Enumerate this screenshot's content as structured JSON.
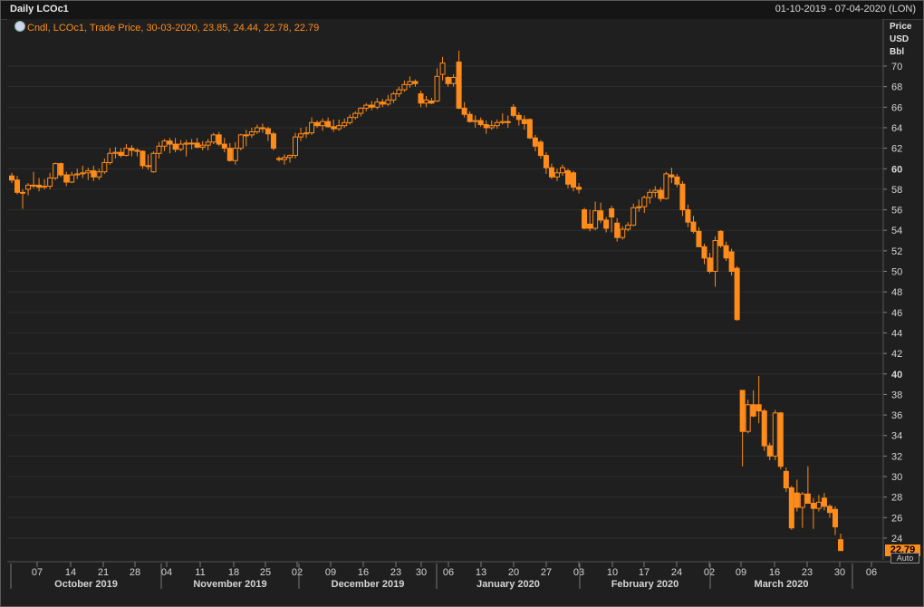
{
  "header": {
    "title": "Daily LCOc1",
    "date_range": "01-10-2019 - 07-04-2020 (LON)"
  },
  "legend": {
    "text": "Cndl, LCOc1, Trade Price, 30-03-2020, 23.85, 24.44, 22.78, 22.79"
  },
  "axis_units": [
    "Price",
    "USD",
    "Bbl"
  ],
  "last_price_label": "22.79",
  "auto_label": "Auto",
  "colors": {
    "candle": "#ff8c1a",
    "background": "#1f1f1f",
    "grid": "#2e2e2e"
  },
  "chart_data": {
    "type": "candlestick",
    "title": "Daily LCOc1",
    "series_name": "LCOc1",
    "ylim": [
      22,
      72
    ],
    "yticks": [
      24,
      26,
      28,
      30,
      32,
      34,
      36,
      38,
      40,
      42,
      44,
      46,
      48,
      50,
      52,
      54,
      56,
      58,
      60,
      62,
      64,
      66,
      68,
      70
    ],
    "bold_yticks": [
      40,
      60
    ],
    "x_tick_labels": [
      "07",
      "14",
      "21",
      "28",
      "04",
      "11",
      "18",
      "25",
      "02",
      "09",
      "16",
      "23",
      "30",
      "06",
      "13",
      "20",
      "27",
      "03",
      "10",
      "17",
      "24",
      "02",
      "09",
      "16",
      "23",
      "30",
      "06"
    ],
    "months": [
      "October 2019",
      "November 2019",
      "December 2019",
      "January 2020",
      "February 2020",
      "March 2020"
    ],
    "candles": [
      {
        "d": "2019-10-01",
        "o": 59.3,
        "h": 59.6,
        "l": 58.6,
        "c": 58.9
      },
      {
        "d": "2019-10-02",
        "o": 58.9,
        "h": 59.3,
        "l": 57.5,
        "c": 57.7
      },
      {
        "d": "2019-10-03",
        "o": 57.7,
        "h": 58.0,
        "l": 56.1,
        "c": 57.7
      },
      {
        "d": "2019-10-04",
        "o": 58.0,
        "h": 58.6,
        "l": 57.4,
        "c": 58.4
      },
      {
        "d": "2019-10-07",
        "o": 58.4,
        "h": 59.7,
        "l": 58.1,
        "c": 58.4
      },
      {
        "d": "2019-10-08",
        "o": 58.4,
        "h": 59.1,
        "l": 57.8,
        "c": 58.2
      },
      {
        "d": "2019-10-09",
        "o": 58.2,
        "h": 59.0,
        "l": 58.0,
        "c": 58.3
      },
      {
        "d": "2019-10-10",
        "o": 58.3,
        "h": 59.6,
        "l": 58.0,
        "c": 59.1
      },
      {
        "d": "2019-10-11",
        "o": 59.1,
        "h": 60.6,
        "l": 58.9,
        "c": 60.5
      },
      {
        "d": "2019-10-14",
        "o": 60.5,
        "h": 60.6,
        "l": 59.2,
        "c": 59.4
      },
      {
        "d": "2019-10-15",
        "o": 59.4,
        "h": 59.7,
        "l": 58.3,
        "c": 58.7
      },
      {
        "d": "2019-10-16",
        "o": 58.7,
        "h": 59.7,
        "l": 58.6,
        "c": 59.4
      },
      {
        "d": "2019-10-17",
        "o": 59.4,
        "h": 60.0,
        "l": 59.0,
        "c": 59.5
      },
      {
        "d": "2019-10-18",
        "o": 59.5,
        "h": 60.3,
        "l": 59.1,
        "c": 59.6
      },
      {
        "d": "2019-10-21",
        "o": 59.6,
        "h": 60.1,
        "l": 58.9,
        "c": 59.8
      },
      {
        "d": "2019-10-22",
        "o": 59.8,
        "h": 60.3,
        "l": 58.8,
        "c": 59.2
      },
      {
        "d": "2019-10-23",
        "o": 59.2,
        "h": 60.0,
        "l": 58.9,
        "c": 59.7
      },
      {
        "d": "2019-10-24",
        "o": 59.7,
        "h": 61.0,
        "l": 59.5,
        "c": 60.6
      },
      {
        "d": "2019-10-25",
        "o": 60.6,
        "h": 62.0,
        "l": 60.4,
        "c": 61.5
      },
      {
        "d": "2019-10-28",
        "o": 61.5,
        "h": 62.1,
        "l": 61.0,
        "c": 61.6
      },
      {
        "d": "2019-10-29",
        "o": 61.6,
        "h": 62.0,
        "l": 61.1,
        "c": 61.3
      },
      {
        "d": "2019-10-30",
        "o": 61.3,
        "h": 62.4,
        "l": 61.2,
        "c": 62.0
      },
      {
        "d": "2019-10-31",
        "o": 62.0,
        "h": 62.3,
        "l": 61.2,
        "c": 61.8
      },
      {
        "d": "2019-11-01",
        "o": 61.8,
        "h": 62.0,
        "l": 61.2,
        "c": 61.7
      },
      {
        "d": "2019-11-04",
        "o": 61.7,
        "h": 61.8,
        "l": 60.0,
        "c": 60.3
      },
      {
        "d": "2019-11-05",
        "o": 60.3,
        "h": 61.4,
        "l": 59.9,
        "c": 60.3
      },
      {
        "d": "2019-11-06",
        "o": 59.7,
        "h": 61.7,
        "l": 59.6,
        "c": 61.5
      },
      {
        "d": "2019-11-07",
        "o": 61.5,
        "h": 62.6,
        "l": 61.0,
        "c": 62.2
      },
      {
        "d": "2019-11-08",
        "o": 62.2,
        "h": 62.9,
        "l": 61.7,
        "c": 62.7
      },
      {
        "d": "2019-11-11",
        "o": 62.7,
        "h": 63.0,
        "l": 61.5,
        "c": 62.4
      },
      {
        "d": "2019-11-12",
        "o": 62.4,
        "h": 63.0,
        "l": 61.6,
        "c": 61.9
      },
      {
        "d": "2019-11-13",
        "o": 61.9,
        "h": 62.8,
        "l": 61.7,
        "c": 62.4
      },
      {
        "d": "2019-11-14",
        "o": 62.4,
        "h": 62.8,
        "l": 61.2,
        "c": 62.5
      },
      {
        "d": "2019-11-15",
        "o": 62.5,
        "h": 62.9,
        "l": 61.9,
        "c": 62.5
      },
      {
        "d": "2019-11-18",
        "o": 62.5,
        "h": 63.0,
        "l": 62.0,
        "c": 62.1
      },
      {
        "d": "2019-11-19",
        "o": 62.1,
        "h": 62.7,
        "l": 61.8,
        "c": 62.3
      },
      {
        "d": "2019-11-20",
        "o": 62.3,
        "h": 62.9,
        "l": 61.8,
        "c": 62.6
      },
      {
        "d": "2019-11-21",
        "o": 62.6,
        "h": 63.5,
        "l": 62.4,
        "c": 63.3
      },
      {
        "d": "2019-11-22",
        "o": 63.3,
        "h": 63.6,
        "l": 62.2,
        "c": 62.4
      },
      {
        "d": "2019-11-25",
        "o": 62.4,
        "h": 63.0,
        "l": 61.6,
        "c": 62.0
      },
      {
        "d": "2019-11-26",
        "o": 62.0,
        "h": 62.5,
        "l": 60.7,
        "c": 60.8
      },
      {
        "d": "2019-11-27",
        "o": 60.8,
        "h": 62.6,
        "l": 60.4,
        "c": 62.0
      },
      {
        "d": "2019-11-28",
        "o": 62.0,
        "h": 63.4,
        "l": 61.8,
        "c": 63.3
      },
      {
        "d": "2019-11-29",
        "o": 63.3,
        "h": 63.8,
        "l": 62.2,
        "c": 63.3
      },
      {
        "d": "2019-12-02",
        "o": 63.3,
        "h": 64.0,
        "l": 63.0,
        "c": 63.6
      },
      {
        "d": "2019-12-03",
        "o": 63.6,
        "h": 64.3,
        "l": 63.4,
        "c": 64.0
      },
      {
        "d": "2019-12-04",
        "o": 64.0,
        "h": 64.4,
        "l": 63.5,
        "c": 63.9
      },
      {
        "d": "2019-12-05",
        "o": 63.9,
        "h": 64.1,
        "l": 62.7,
        "c": 63.4
      },
      {
        "d": "2019-12-06",
        "o": 63.4,
        "h": 63.6,
        "l": 61.8,
        "c": 62.0
      },
      {
        "d": "2019-12-09",
        "o": 61.0,
        "h": 61.2,
        "l": 60.7,
        "c": 60.9
      },
      {
        "d": "2019-12-10",
        "o": 60.9,
        "h": 61.4,
        "l": 60.4,
        "c": 61.1
      },
      {
        "d": "2019-12-11",
        "o": 61.1,
        "h": 61.4,
        "l": 60.6,
        "c": 61.3
      },
      {
        "d": "2019-12-12",
        "o": 61.3,
        "h": 63.5,
        "l": 61.0,
        "c": 63.1
      },
      {
        "d": "2019-12-13",
        "o": 63.1,
        "h": 64.0,
        "l": 62.7,
        "c": 63.4
      },
      {
        "d": "2019-12-16",
        "o": 63.4,
        "h": 64.1,
        "l": 63.0,
        "c": 63.5
      },
      {
        "d": "2019-12-17",
        "o": 63.5,
        "h": 65.0,
        "l": 63.3,
        "c": 64.5
      },
      {
        "d": "2019-12-18",
        "o": 64.5,
        "h": 64.7,
        "l": 64.0,
        "c": 64.2
      },
      {
        "d": "2019-12-19",
        "o": 64.2,
        "h": 64.9,
        "l": 63.7,
        "c": 64.6
      },
      {
        "d": "2019-12-20",
        "o": 64.6,
        "h": 65.0,
        "l": 64.0,
        "c": 64.1
      },
      {
        "d": "2019-12-23",
        "o": 64.1,
        "h": 64.8,
        "l": 63.6,
        "c": 63.9
      },
      {
        "d": "2019-12-24",
        "o": 63.9,
        "h": 64.8,
        "l": 63.7,
        "c": 64.2
      },
      {
        "d": "2019-12-26",
        "o": 64.2,
        "h": 64.9,
        "l": 64.0,
        "c": 64.5
      },
      {
        "d": "2019-12-27",
        "o": 64.5,
        "h": 65.3,
        "l": 64.3,
        "c": 65.0
      },
      {
        "d": "2019-12-30",
        "o": 65.0,
        "h": 65.6,
        "l": 64.8,
        "c": 65.4
      },
      {
        "d": "2019-12-31",
        "o": 65.4,
        "h": 66.0,
        "l": 65.1,
        "c": 65.9
      },
      {
        "d": "2020-01-02",
        "o": 65.9,
        "h": 66.4,
        "l": 65.6,
        "c": 66.2
      },
      {
        "d": "2020-01-03",
        "o": 66.2,
        "h": 66.6,
        "l": 65.7,
        "c": 66.0
      },
      {
        "d": "2020-01-06",
        "o": 66.0,
        "h": 66.9,
        "l": 65.8,
        "c": 66.5
      },
      {
        "d": "2020-01-07",
        "o": 66.5,
        "h": 66.8,
        "l": 66.0,
        "c": 66.3
      },
      {
        "d": "2020-01-08",
        "o": 66.3,
        "h": 67.2,
        "l": 66.1,
        "c": 66.7
      },
      {
        "d": "2020-01-09",
        "o": 66.7,
        "h": 67.5,
        "l": 66.4,
        "c": 67.3
      },
      {
        "d": "2020-01-10",
        "o": 67.3,
        "h": 68.0,
        "l": 67.0,
        "c": 67.7
      },
      {
        "d": "2020-01-13",
        "o": 67.7,
        "h": 68.6,
        "l": 67.5,
        "c": 68.2
      },
      {
        "d": "2020-01-14",
        "o": 68.2,
        "h": 69.0,
        "l": 67.9,
        "c": 68.5
      },
      {
        "d": "2020-01-15",
        "o": 68.5,
        "h": 68.7,
        "l": 68.0,
        "c": 68.3
      },
      {
        "d": "2020-01-16",
        "o": 67.3,
        "h": 67.6,
        "l": 66.0,
        "c": 66.4
      },
      {
        "d": "2020-01-17",
        "o": 66.4,
        "h": 67.1,
        "l": 66.0,
        "c": 66.7
      },
      {
        "d": "2020-01-20",
        "o": 66.6,
        "h": 66.9,
        "l": 66.3,
        "c": 66.4
      },
      {
        "d": "2020-01-21",
        "o": 66.6,
        "h": 69.8,
        "l": 66.5,
        "c": 69.0
      },
      {
        "d": "2020-01-22",
        "o": 69.2,
        "h": 70.9,
        "l": 68.6,
        "c": 70.3
      },
      {
        "d": "2020-01-23",
        "o": 68.9,
        "h": 69.0,
        "l": 68.0,
        "c": 68.3
      },
      {
        "d": "2020-01-24",
        "o": 68.3,
        "h": 69.2,
        "l": 68.0,
        "c": 68.9
      },
      {
        "d": "2020-01-27",
        "o": 70.4,
        "h": 71.5,
        "l": 65.8,
        "c": 65.9
      },
      {
        "d": "2020-01-28",
        "o": 65.9,
        "h": 66.5,
        "l": 65.0,
        "c": 65.3
      },
      {
        "d": "2020-01-29",
        "o": 65.3,
        "h": 65.6,
        "l": 64.5,
        "c": 64.6
      },
      {
        "d": "2020-01-30",
        "o": 64.6,
        "h": 65.2,
        "l": 64.0,
        "c": 64.7
      },
      {
        "d": "2020-01-31",
        "o": 64.7,
        "h": 65.0,
        "l": 64.1,
        "c": 64.3
      },
      {
        "d": "2020-02-03",
        "o": 64.3,
        "h": 64.7,
        "l": 63.4,
        "c": 64.0
      },
      {
        "d": "2020-02-04",
        "o": 64.0,
        "h": 64.7,
        "l": 63.8,
        "c": 64.2
      },
      {
        "d": "2020-02-05",
        "o": 64.2,
        "h": 64.8,
        "l": 63.9,
        "c": 64.5
      },
      {
        "d": "2020-02-06",
        "o": 64.5,
        "h": 65.4,
        "l": 64.3,
        "c": 64.6
      },
      {
        "d": "2020-02-07",
        "o": 64.6,
        "h": 65.2,
        "l": 64.0,
        "c": 64.5
      },
      {
        "d": "2020-02-10",
        "o": 66.0,
        "h": 66.3,
        "l": 65.0,
        "c": 65.2
      },
      {
        "d": "2020-02-11",
        "o": 65.2,
        "h": 65.5,
        "l": 64.2,
        "c": 64.8
      },
      {
        "d": "2020-02-12",
        "o": 64.8,
        "h": 65.2,
        "l": 63.8,
        "c": 64.4
      },
      {
        "d": "2020-02-13",
        "o": 64.8,
        "h": 64.9,
        "l": 62.9,
        "c": 63.0
      },
      {
        "d": "2020-02-14",
        "o": 63.0,
        "h": 63.3,
        "l": 61.7,
        "c": 62.2
      },
      {
        "d": "2020-02-17",
        "o": 62.6,
        "h": 62.8,
        "l": 61.0,
        "c": 61.3
      },
      {
        "d": "2020-02-18",
        "o": 61.3,
        "h": 61.6,
        "l": 59.5,
        "c": 60.1
      },
      {
        "d": "2020-02-19",
        "o": 60.1,
        "h": 60.5,
        "l": 59.0,
        "c": 59.2
      },
      {
        "d": "2020-02-20",
        "o": 59.2,
        "h": 60.0,
        "l": 58.8,
        "c": 59.6
      },
      {
        "d": "2020-02-21",
        "o": 59.6,
        "h": 60.4,
        "l": 59.3,
        "c": 60.1
      },
      {
        "d": "2020-02-24",
        "o": 59.8,
        "h": 60.0,
        "l": 58.1,
        "c": 58.5
      },
      {
        "d": "2020-02-25",
        "o": 59.6,
        "h": 59.8,
        "l": 57.8,
        "c": 58.2
      },
      {
        "d": "2020-02-26",
        "o": 58.2,
        "h": 58.6,
        "l": 57.6,
        "c": 58.0
      },
      {
        "d": "2020-02-27",
        "o": 56.0,
        "h": 56.2,
        "l": 54.1,
        "c": 54.2
      },
      {
        "d": "2020-02-28",
        "o": 54.6,
        "h": 56.0,
        "l": 53.9,
        "c": 54.2
      },
      {
        "d": "2020-03-02",
        "o": 54.2,
        "h": 56.8,
        "l": 54.0,
        "c": 55.9
      },
      {
        "d": "2020-03-03",
        "o": 55.9,
        "h": 56.7,
        "l": 54.7,
        "c": 55.0
      },
      {
        "d": "2020-03-04",
        "o": 55.0,
        "h": 55.3,
        "l": 53.8,
        "c": 54.2
      },
      {
        "d": "2020-03-05",
        "o": 56.1,
        "h": 56.4,
        "l": 53.8,
        "c": 55.3
      },
      {
        "d": "2020-03-06",
        "o": 54.7,
        "h": 55.2,
        "l": 52.9,
        "c": 53.3
      },
      {
        "d": "2020-03-09",
        "o": 53.3,
        "h": 54.4,
        "l": 53.1,
        "c": 54.1
      },
      {
        "d": "2020-03-10",
        "o": 54.1,
        "h": 54.8,
        "l": 53.9,
        "c": 54.5
      },
      {
        "d": "2020-03-11",
        "o": 54.5,
        "h": 56.6,
        "l": 54.4,
        "c": 56.2
      },
      {
        "d": "2020-03-12",
        "o": 56.2,
        "h": 57.0,
        "l": 55.8,
        "c": 56.3
      },
      {
        "d": "2020-03-13",
        "o": 56.3,
        "h": 57.4,
        "l": 55.7,
        "c": 57.2
      },
      {
        "d": "2020-03-16",
        "o": 57.2,
        "h": 58.0,
        "l": 56.6,
        "c": 57.7
      },
      {
        "d": "2020-03-17",
        "o": 57.7,
        "h": 58.3,
        "l": 57.2,
        "c": 57.9
      },
      {
        "d": "2020-03-18",
        "o": 57.9,
        "h": 58.2,
        "l": 56.8,
        "c": 57.1
      },
      {
        "d": "2020-03-19",
        "o": 57.1,
        "h": 59.7,
        "l": 57.0,
        "c": 59.5
      },
      {
        "d": "2020-03-20",
        "o": 59.4,
        "h": 60.1,
        "l": 58.6,
        "c": 59.2
      },
      {
        "d": "2020-03-23",
        "o": 59.2,
        "h": 59.5,
        "l": 58.2,
        "c": 58.5
      },
      {
        "d": "2020-03-24",
        "o": 58.5,
        "h": 58.8,
        "l": 55.4,
        "c": 56.0
      },
      {
        "d": "2020-03-25",
        "o": 56.0,
        "h": 56.5,
        "l": 54.3,
        "c": 54.8
      },
      {
        "d": "2020-03-26",
        "o": 54.8,
        "h": 55.4,
        "l": 53.7,
        "c": 53.9
      },
      {
        "d": "2020-03-27",
        "o": 53.9,
        "h": 54.3,
        "l": 52.4,
        "c": 52.4
      },
      {
        "d": "2020-03-30",
        "o": 52.4,
        "h": 52.7,
        "l": 50.7,
        "c": 51.3
      },
      {
        "d": "2020-03-31",
        "o": 51.3,
        "h": 51.8,
        "l": 49.8,
        "c": 50.0
      },
      {
        "d": "2020-04-01",
        "o": 50.0,
        "h": 53.4,
        "l": 48.5,
        "c": 53.0
      },
      {
        "d": "2020-04-02",
        "o": 53.9,
        "h": 54.0,
        "l": 52.3,
        "c": 52.5
      },
      {
        "d": "2020-04-03",
        "o": 52.5,
        "h": 52.9,
        "l": 51.0,
        "c": 51.3
      },
      {
        "d": "2020-04-06",
        "o": 51.9,
        "h": 52.2,
        "l": 49.6,
        "c": 50.0
      },
      {
        "d": "2020-04-07",
        "o": 50.3,
        "h": 50.5,
        "l": 45.2,
        "c": 45.3
      },
      {
        "d": "2020-03-09b",
        "o": 38.4,
        "h": 38.4,
        "l": 31.0,
        "c": 34.4
      },
      {
        "d": "2020-03-10",
        "o": 34.4,
        "h": 37.5,
        "l": 34.2,
        "c": 37.0
      },
      {
        "d": "2020-03-11",
        "o": 37.0,
        "h": 38.4,
        "l": 35.8,
        "c": 35.9
      },
      {
        "d": "2020-03-12",
        "o": 37.0,
        "h": 39.8,
        "l": 35.2,
        "c": 36.4
      },
      {
        "d": "2020-03-13",
        "o": 36.4,
        "h": 36.6,
        "l": 32.5,
        "c": 33.0
      },
      {
        "d": "2020-03-16",
        "o": 33.0,
        "h": 33.3,
        "l": 31.6,
        "c": 32.0
      },
      {
        "d": "2020-03-17",
        "o": 32.0,
        "h": 36.5,
        "l": 31.6,
        "c": 36.2
      },
      {
        "d": "2020-03-18",
        "o": 36.2,
        "h": 36.3,
        "l": 30.7,
        "c": 31.0
      },
      {
        "d": "2020-03-19",
        "o": 30.5,
        "h": 30.9,
        "l": 28.5,
        "c": 28.9
      },
      {
        "d": "2020-03-20",
        "o": 28.9,
        "h": 29.1,
        "l": 24.8,
        "c": 25.0
      },
      {
        "d": "2020-03-23",
        "o": 28.4,
        "h": 29.7,
        "l": 26.6,
        "c": 27.0
      },
      {
        "d": "2020-03-24",
        "o": 27.0,
        "h": 28.5,
        "l": 25.0,
        "c": 28.3
      },
      {
        "d": "2020-03-25",
        "o": 28.3,
        "h": 31.0,
        "l": 27.5,
        "c": 27.4
      },
      {
        "d": "2020-03-26",
        "o": 27.4,
        "h": 27.9,
        "l": 24.9,
        "c": 26.9
      },
      {
        "d": "2020-03-27",
        "o": 26.9,
        "h": 28.2,
        "l": 26.6,
        "c": 27.5
      },
      {
        "d": "2020-03-30",
        "o": 27.9,
        "h": 28.4,
        "l": 26.7,
        "c": 27.1
      },
      {
        "d": "2020-03-31",
        "o": 27.1,
        "h": 27.3,
        "l": 26.0,
        "c": 26.5
      },
      {
        "d": "2020-04-01",
        "o": 26.8,
        "h": 27.1,
        "l": 24.3,
        "c": 25.1
      },
      {
        "d": "2020-04-02",
        "o": 23.85,
        "h": 24.44,
        "l": 22.78,
        "c": 22.79
      }
    ]
  }
}
